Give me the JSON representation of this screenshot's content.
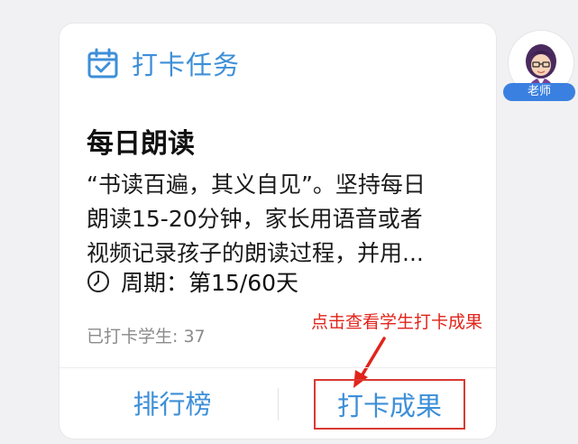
{
  "header": {
    "label": "打卡任务",
    "icon": "calendar-check-icon",
    "color": "#3d8fd8"
  },
  "task": {
    "title": "每日朗读",
    "description_lines": [
      "“书读百遍，其义自见”。坚持每日",
      "朗读15-20分钟，家长用语音或者",
      "视频记录孩子的朗读过程，并用..."
    ],
    "period": "周期：第15/60天",
    "period_icon": "clock-icon",
    "checked_in": "已打卡学生: 37"
  },
  "annotation": {
    "hint": "点击查看学生打卡成果",
    "color": "#e2231a"
  },
  "actions": {
    "rank_label": "排行榜",
    "result_label": "打卡成果"
  },
  "teacher": {
    "badge": "老师",
    "badge_color": "#3a80e0"
  }
}
